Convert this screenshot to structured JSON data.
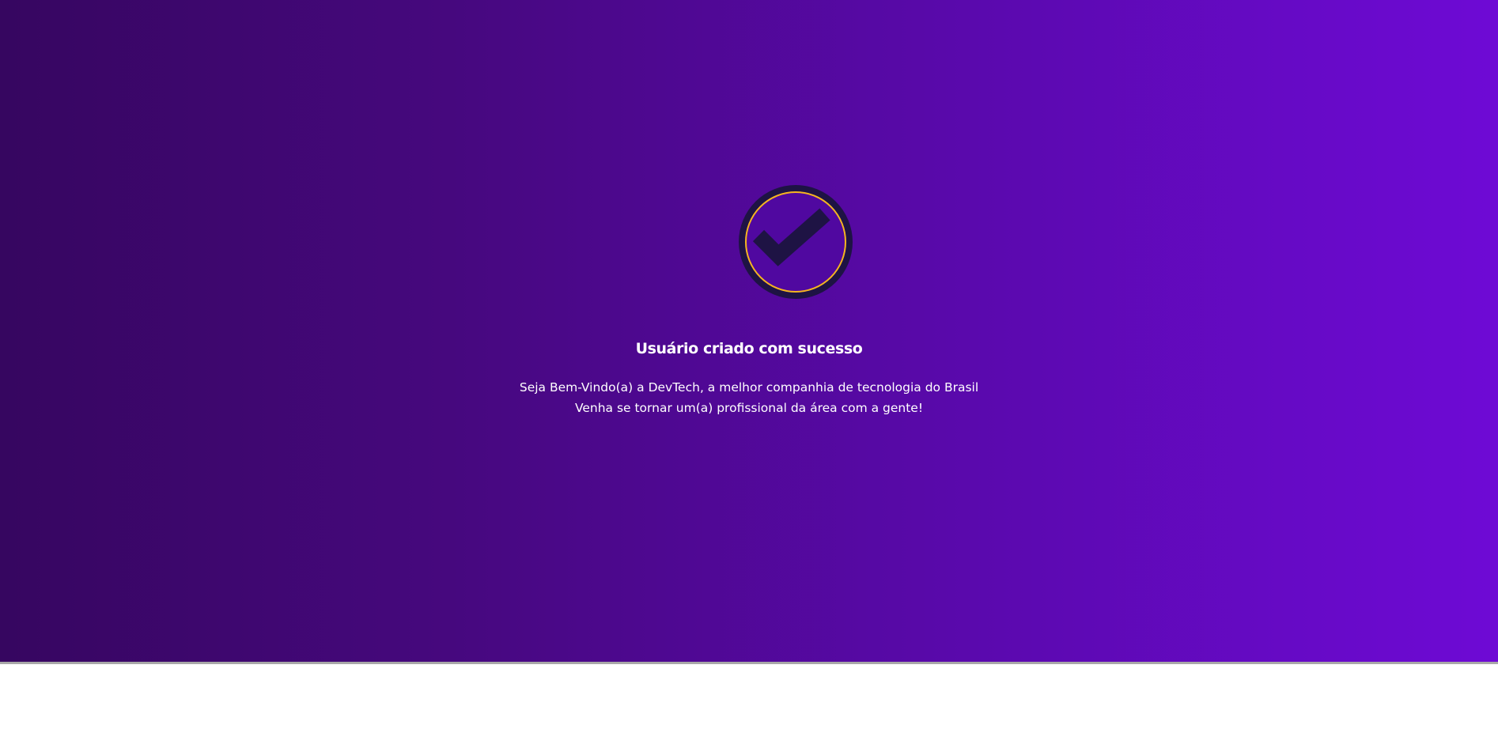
{
  "success": {
    "icon": "check-circle-icon",
    "title": "Usuário criado com sucesso",
    "message_line_1": "Seja Bem-Vindo(a) a DevTech, a melhor companhia de tecnologia do Brasil",
    "message_line_2": "Venha se tornar um(a) profissional da área com a gente!"
  },
  "colors": {
    "gradient_start": "#360660",
    "gradient_end": "#6e0ad5",
    "icon_dark": "#1e1344",
    "icon_ring": "#f5b61e",
    "text": "#ffffff"
  }
}
